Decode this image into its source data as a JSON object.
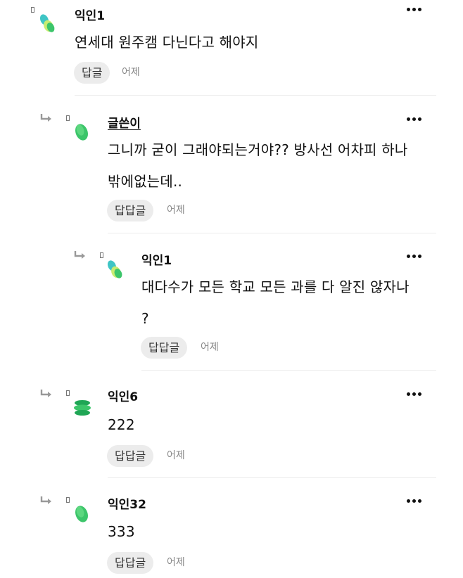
{
  "comments": [
    {
      "author": "익인1",
      "lines": [
        "연세대 원주캠 다닌다고 해야지"
      ],
      "reply_label": "답글",
      "time": "어제"
    },
    {
      "author": "글쓴이",
      "lines": [
        "그니까 굳이 그래야되는거야?? 방사선 어차피 하나",
        "밖에없는데.."
      ],
      "reply_label": "답답글",
      "time": "어제"
    },
    {
      "author": "익인1",
      "lines": [
        "대다수가 모든 학교 모든 과를 다 알진 않자나",
        "?"
      ],
      "reply_label": "답답글",
      "time": "어제"
    },
    {
      "author": "익인6",
      "lines": [
        "222"
      ],
      "reply_label": "답답글",
      "time": "어제"
    },
    {
      "author": "익인32",
      "lines": [
        "333"
      ],
      "reply_label": "답답글",
      "time": "어제"
    }
  ],
  "colors": {
    "avatar_teal": "#3fc5c5",
    "avatar_green": "#3cc56a",
    "avatar_lime": "#c9ec72",
    "avatar_dark_green": "#1fa655"
  },
  "icons": {
    "reply_arrow": "reply-arrow-icon",
    "more": "more-dots-icon"
  }
}
